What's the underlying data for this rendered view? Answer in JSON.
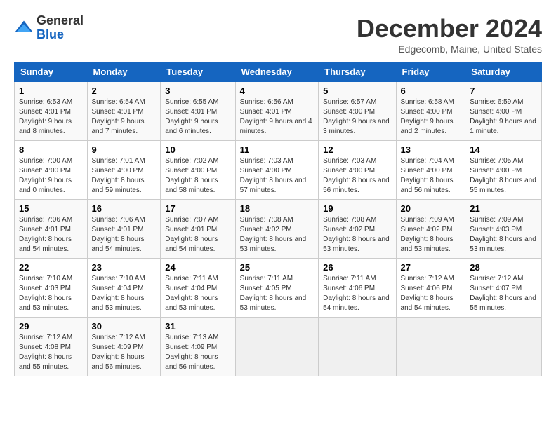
{
  "logo": {
    "line1": "General",
    "line2": "Blue"
  },
  "title": "December 2024",
  "subtitle": "Edgecomb, Maine, United States",
  "days_of_week": [
    "Sunday",
    "Monday",
    "Tuesday",
    "Wednesday",
    "Thursday",
    "Friday",
    "Saturday"
  ],
  "weeks": [
    [
      {
        "day": 1,
        "sunrise": "6:53 AM",
        "sunset": "4:01 PM",
        "daylight": "9 hours and 8 minutes."
      },
      {
        "day": 2,
        "sunrise": "6:54 AM",
        "sunset": "4:01 PM",
        "daylight": "9 hours and 7 minutes."
      },
      {
        "day": 3,
        "sunrise": "6:55 AM",
        "sunset": "4:01 PM",
        "daylight": "9 hours and 6 minutes."
      },
      {
        "day": 4,
        "sunrise": "6:56 AM",
        "sunset": "4:01 PM",
        "daylight": "9 hours and 4 minutes."
      },
      {
        "day": 5,
        "sunrise": "6:57 AM",
        "sunset": "4:00 PM",
        "daylight": "9 hours and 3 minutes."
      },
      {
        "day": 6,
        "sunrise": "6:58 AM",
        "sunset": "4:00 PM",
        "daylight": "9 hours and 2 minutes."
      },
      {
        "day": 7,
        "sunrise": "6:59 AM",
        "sunset": "4:00 PM",
        "daylight": "9 hours and 1 minute."
      }
    ],
    [
      {
        "day": 8,
        "sunrise": "7:00 AM",
        "sunset": "4:00 PM",
        "daylight": "9 hours and 0 minutes."
      },
      {
        "day": 9,
        "sunrise": "7:01 AM",
        "sunset": "4:00 PM",
        "daylight": "8 hours and 59 minutes."
      },
      {
        "day": 10,
        "sunrise": "7:02 AM",
        "sunset": "4:00 PM",
        "daylight": "8 hours and 58 minutes."
      },
      {
        "day": 11,
        "sunrise": "7:03 AM",
        "sunset": "4:00 PM",
        "daylight": "8 hours and 57 minutes."
      },
      {
        "day": 12,
        "sunrise": "7:03 AM",
        "sunset": "4:00 PM",
        "daylight": "8 hours and 56 minutes."
      },
      {
        "day": 13,
        "sunrise": "7:04 AM",
        "sunset": "4:00 PM",
        "daylight": "8 hours and 56 minutes."
      },
      {
        "day": 14,
        "sunrise": "7:05 AM",
        "sunset": "4:00 PM",
        "daylight": "8 hours and 55 minutes."
      }
    ],
    [
      {
        "day": 15,
        "sunrise": "7:06 AM",
        "sunset": "4:01 PM",
        "daylight": "8 hours and 54 minutes."
      },
      {
        "day": 16,
        "sunrise": "7:06 AM",
        "sunset": "4:01 PM",
        "daylight": "8 hours and 54 minutes."
      },
      {
        "day": 17,
        "sunrise": "7:07 AM",
        "sunset": "4:01 PM",
        "daylight": "8 hours and 54 minutes."
      },
      {
        "day": 18,
        "sunrise": "7:08 AM",
        "sunset": "4:02 PM",
        "daylight": "8 hours and 53 minutes."
      },
      {
        "day": 19,
        "sunrise": "7:08 AM",
        "sunset": "4:02 PM",
        "daylight": "8 hours and 53 minutes."
      },
      {
        "day": 20,
        "sunrise": "7:09 AM",
        "sunset": "4:02 PM",
        "daylight": "8 hours and 53 minutes."
      },
      {
        "day": 21,
        "sunrise": "7:09 AM",
        "sunset": "4:03 PM",
        "daylight": "8 hours and 53 minutes."
      }
    ],
    [
      {
        "day": 22,
        "sunrise": "7:10 AM",
        "sunset": "4:03 PM",
        "daylight": "8 hours and 53 minutes."
      },
      {
        "day": 23,
        "sunrise": "7:10 AM",
        "sunset": "4:04 PM",
        "daylight": "8 hours and 53 minutes."
      },
      {
        "day": 24,
        "sunrise": "7:11 AM",
        "sunset": "4:04 PM",
        "daylight": "8 hours and 53 minutes."
      },
      {
        "day": 25,
        "sunrise": "7:11 AM",
        "sunset": "4:05 PM",
        "daylight": "8 hours and 53 minutes."
      },
      {
        "day": 26,
        "sunrise": "7:11 AM",
        "sunset": "4:06 PM",
        "daylight": "8 hours and 54 minutes."
      },
      {
        "day": 27,
        "sunrise": "7:12 AM",
        "sunset": "4:06 PM",
        "daylight": "8 hours and 54 minutes."
      },
      {
        "day": 28,
        "sunrise": "7:12 AM",
        "sunset": "4:07 PM",
        "daylight": "8 hours and 55 minutes."
      }
    ],
    [
      {
        "day": 29,
        "sunrise": "7:12 AM",
        "sunset": "4:08 PM",
        "daylight": "8 hours and 55 minutes."
      },
      {
        "day": 30,
        "sunrise": "7:12 AM",
        "sunset": "4:09 PM",
        "daylight": "8 hours and 56 minutes."
      },
      {
        "day": 31,
        "sunrise": "7:13 AM",
        "sunset": "4:09 PM",
        "daylight": "8 hours and 56 minutes."
      },
      null,
      null,
      null,
      null
    ]
  ]
}
